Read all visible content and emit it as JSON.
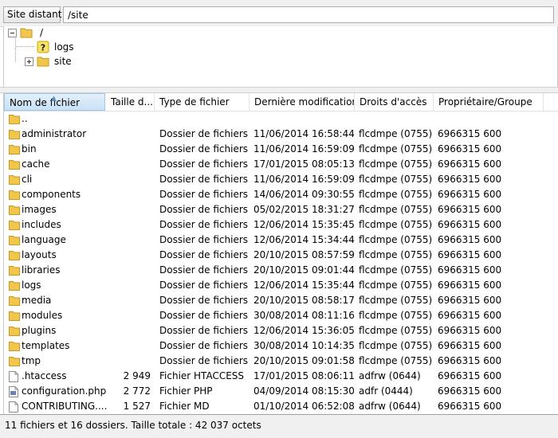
{
  "path_bar": {
    "label": "Site distant :",
    "value": "/site"
  },
  "tree": {
    "root": "/",
    "children": [
      {
        "label": "logs",
        "icon": "question-folder-icon"
      },
      {
        "label": "site",
        "icon": "folder-icon",
        "expand": "+"
      }
    ]
  },
  "columns": {
    "name": "Nom de fichier",
    "size": "Taille d...",
    "type": "Type de fichier",
    "modified": "Dernière modification",
    "permissions": "Droits d'accès",
    "owner": "Propriétaire/Groupe"
  },
  "files": [
    {
      "name": "..",
      "size": "",
      "type": "",
      "modified": "",
      "permissions": "",
      "owner": "",
      "icon": "folder-icon"
    },
    {
      "name": "administrator",
      "size": "",
      "type": "Dossier de fichiers",
      "modified": "11/06/2014 16:58:44",
      "permissions": "flcdmpe (0755)",
      "owner": "6966315 600",
      "icon": "folder-icon"
    },
    {
      "name": "bin",
      "size": "",
      "type": "Dossier de fichiers",
      "modified": "11/06/2014 16:59:09",
      "permissions": "flcdmpe (0755)",
      "owner": "6966315 600",
      "icon": "folder-icon"
    },
    {
      "name": "cache",
      "size": "",
      "type": "Dossier de fichiers",
      "modified": "17/01/2015 08:05:13",
      "permissions": "flcdmpe (0755)",
      "owner": "6966315 600",
      "icon": "folder-icon"
    },
    {
      "name": "cli",
      "size": "",
      "type": "Dossier de fichiers",
      "modified": "11/06/2014 16:59:09",
      "permissions": "flcdmpe (0755)",
      "owner": "6966315 600",
      "icon": "folder-icon"
    },
    {
      "name": "components",
      "size": "",
      "type": "Dossier de fichiers",
      "modified": "14/06/2014 09:30:55",
      "permissions": "flcdmpe (0755)",
      "owner": "6966315 600",
      "icon": "folder-icon"
    },
    {
      "name": "images",
      "size": "",
      "type": "Dossier de fichiers",
      "modified": "05/02/2015 18:31:27",
      "permissions": "flcdmpe (0755)",
      "owner": "6966315 600",
      "icon": "folder-icon"
    },
    {
      "name": "includes",
      "size": "",
      "type": "Dossier de fichiers",
      "modified": "12/06/2014 15:35:45",
      "permissions": "flcdmpe (0755)",
      "owner": "6966315 600",
      "icon": "folder-icon"
    },
    {
      "name": "language",
      "size": "",
      "type": "Dossier de fichiers",
      "modified": "12/06/2014 15:34:44",
      "permissions": "flcdmpe (0755)",
      "owner": "6966315 600",
      "icon": "folder-icon"
    },
    {
      "name": "layouts",
      "size": "",
      "type": "Dossier de fichiers",
      "modified": "20/10/2015 08:57:59",
      "permissions": "flcdmpe (0755)",
      "owner": "6966315 600",
      "icon": "folder-icon"
    },
    {
      "name": "libraries",
      "size": "",
      "type": "Dossier de fichiers",
      "modified": "20/10/2015 09:01:44",
      "permissions": "flcdmpe (0755)",
      "owner": "6966315 600",
      "icon": "folder-icon"
    },
    {
      "name": "logs",
      "size": "",
      "type": "Dossier de fichiers",
      "modified": "12/06/2014 15:35:44",
      "permissions": "flcdmpe (0755)",
      "owner": "6966315 600",
      "icon": "folder-icon"
    },
    {
      "name": "media",
      "size": "",
      "type": "Dossier de fichiers",
      "modified": "20/10/2015 08:58:17",
      "permissions": "flcdmpe (0755)",
      "owner": "6966315 600",
      "icon": "folder-icon"
    },
    {
      "name": "modules",
      "size": "",
      "type": "Dossier de fichiers",
      "modified": "30/08/2014 08:11:16",
      "permissions": "flcdmpe (0755)",
      "owner": "6966315 600",
      "icon": "folder-icon"
    },
    {
      "name": "plugins",
      "size": "",
      "type": "Dossier de fichiers",
      "modified": "12/06/2014 15:36:05",
      "permissions": "flcdmpe (0755)",
      "owner": "6966315 600",
      "icon": "folder-icon"
    },
    {
      "name": "templates",
      "size": "",
      "type": "Dossier de fichiers",
      "modified": "30/08/2014 10:14:35",
      "permissions": "flcdmpe (0755)",
      "owner": "6966315 600",
      "icon": "folder-icon"
    },
    {
      "name": "tmp",
      "size": "",
      "type": "Dossier de fichiers",
      "modified": "20/10/2015 09:01:58",
      "permissions": "flcdmpe (0755)",
      "owner": "6966315 600",
      "icon": "folder-icon"
    },
    {
      "name": ".htaccess",
      "size": "2 949",
      "type": "Fichier HTACCESS",
      "modified": "17/01/2015 08:06:11",
      "permissions": "adfrw (0644)",
      "owner": "6966315 600",
      "icon": "file-icon"
    },
    {
      "name": "configuration.php",
      "size": "2 772",
      "type": "Fichier PHP",
      "modified": "04/09/2014 08:15:30",
      "permissions": "adfr (0444)",
      "owner": "6966315 600",
      "icon": "php-file-icon"
    },
    {
      "name": "CONTRIBUTING....",
      "size": "1 527",
      "type": "Fichier MD",
      "modified": "01/10/2014 06:52:08",
      "permissions": "adfrw (0644)",
      "owner": "6966315 600",
      "icon": "file-icon"
    }
  ],
  "status": "11 fichiers et 16 dossiers. Taille totale : 42 037 octets",
  "colors": {
    "folder": "#f0c64b",
    "folder_dark": "#c99a20",
    "header_active": "#c9e2f7",
    "question": "#e0b800"
  }
}
